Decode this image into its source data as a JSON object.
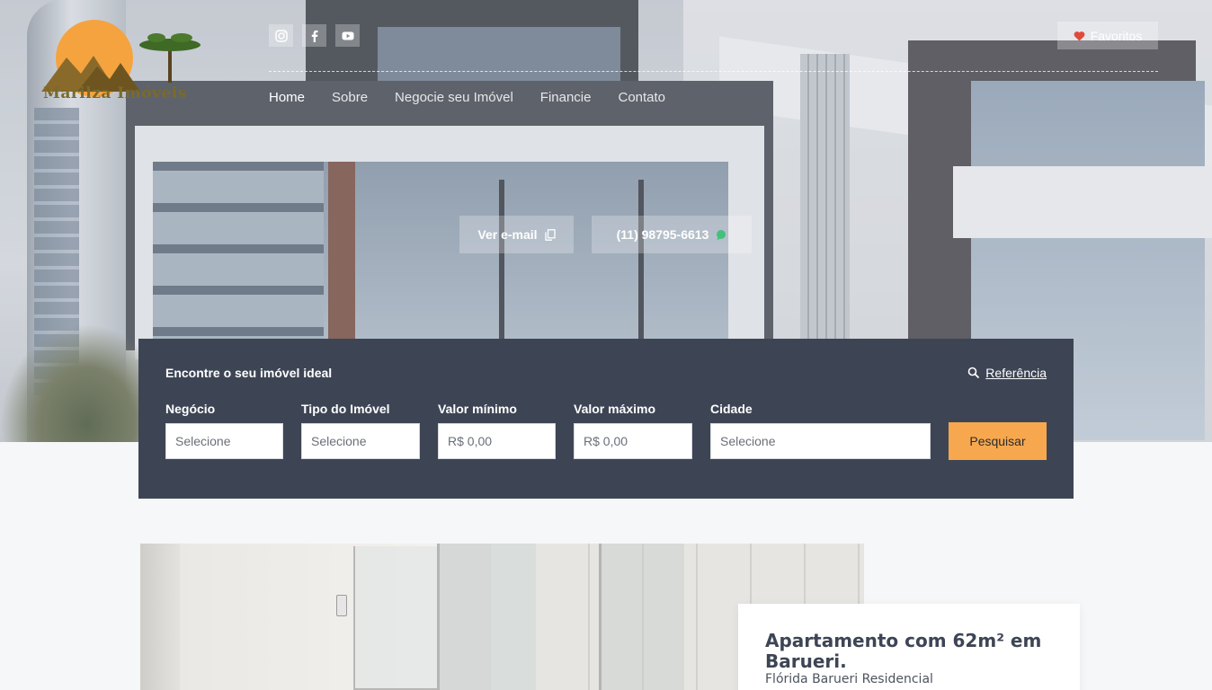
{
  "brand": {
    "logo_text": "Marilza Imóveis"
  },
  "social": [
    {
      "name": "instagram-icon"
    },
    {
      "name": "facebook-icon"
    },
    {
      "name": "youtube-icon"
    }
  ],
  "favorites": {
    "label": "Favoritos"
  },
  "nav": {
    "items": [
      {
        "label": "Home"
      },
      {
        "label": "Sobre"
      },
      {
        "label": "Negocie seu Imóvel"
      },
      {
        "label": "Financie"
      },
      {
        "label": "Contato"
      }
    ]
  },
  "contact": {
    "email_label": "Ver e-mail",
    "phone_label": "(11) 98795-6613"
  },
  "search": {
    "title": "Encontre o seu imóvel ideal",
    "reference_label": "Referência",
    "fields": {
      "negocio": {
        "label": "Negócio",
        "value": "Selecione"
      },
      "tipo": {
        "label": "Tipo do Imóvel",
        "value": "Selecione"
      },
      "valor_min": {
        "label": "Valor mínimo",
        "placeholder": "R$ 0,00"
      },
      "valor_max": {
        "label": "Valor máximo",
        "placeholder": "R$ 0,00"
      },
      "cidade": {
        "label": "Cidade",
        "value": "Selecione"
      }
    },
    "submit_label": "Pesquisar"
  },
  "listing": {
    "title": "Apartamento com 62m² em Barueri.",
    "subtitle": "Flórida Barueri Residencial"
  },
  "colors": {
    "panel": "#3d4555",
    "accent": "#f7a84f",
    "heart": "#e04a3b",
    "whatsapp": "#2fbf71"
  }
}
